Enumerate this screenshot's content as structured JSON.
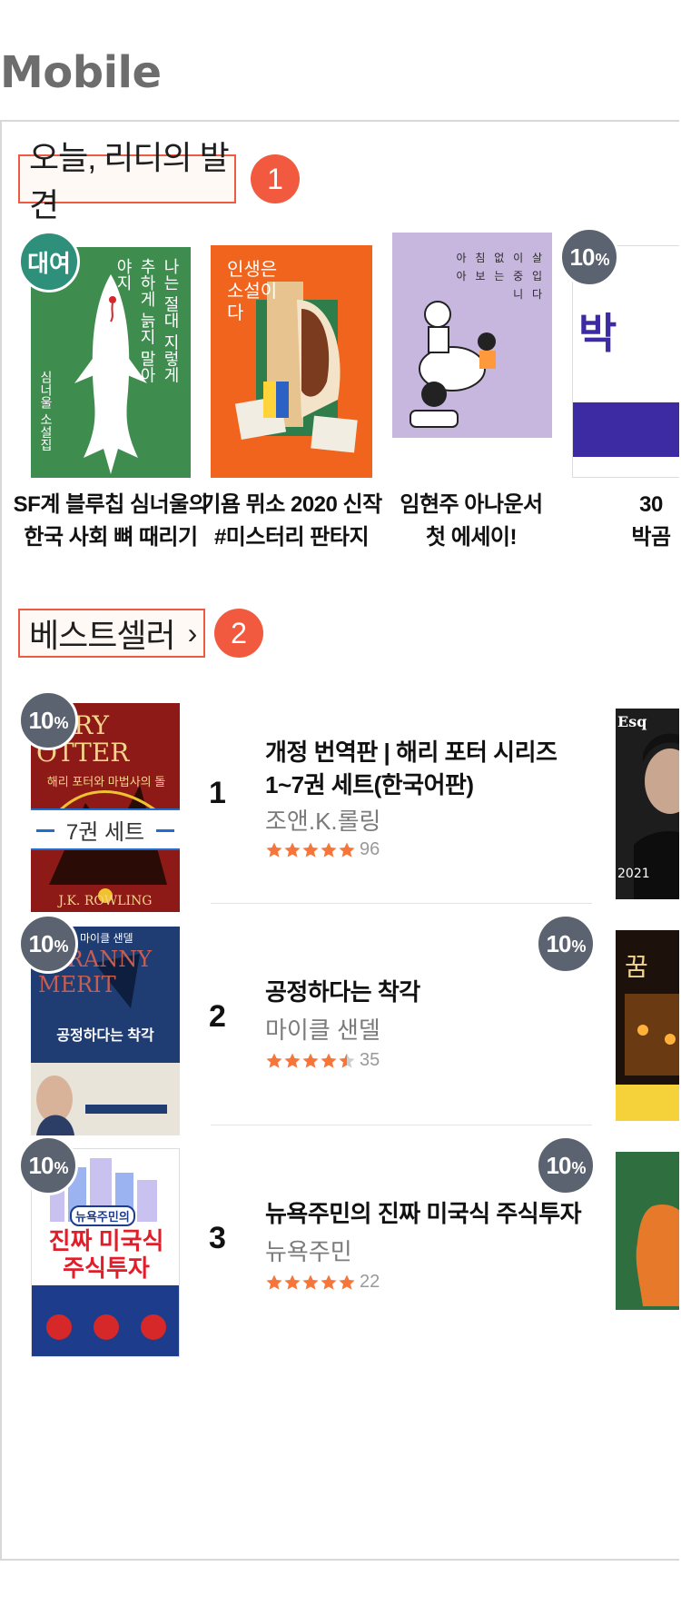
{
  "page_heading": "Mobile",
  "discover": {
    "title": "오늘, 리디의 발견",
    "number": "1",
    "items": [
      {
        "caption_line1": "SF계 블루칩 심너울의",
        "caption_line2": "한국 사회 뼈 때리기",
        "badge": "대여",
        "cover_text": "나는 절대 지렇게 추하게 늙지 말아야지",
        "cover_author": "심너울 소설집",
        "cover_color": "#3f8c4f"
      },
      {
        "caption_line1": "기욤 뮈소 2020 신작",
        "caption_line2": "#미스터리 판타지",
        "badge": "",
        "cover_text": "인생은 소설이다",
        "cover_color": "#f0641e"
      },
      {
        "caption_line1": "임현주 아나운서",
        "caption_line2": "첫 에세이!",
        "badge": "",
        "cover_text": "아 침 없 이 살 아 보 는 중 입 니 다",
        "cover_color": "#c7b6de"
      },
      {
        "caption_line1": "30",
        "caption_line2": "박곰",
        "badge": "10%",
        "cover_text": "박",
        "cover_color": "#ffffff"
      }
    ]
  },
  "bestseller": {
    "title": "베스트셀러",
    "number": "2",
    "items": [
      {
        "rank": "1",
        "title": "개정 번역판 | 해리 포터 시리즈 1~7권 세트(한국어판)",
        "author": "조앤.K.롤링",
        "rating": 5,
        "count": "96",
        "badge": "10%",
        "band": "7권 세트",
        "cover_text_top": "ARRY OTTER",
        "cover_sub": "해리 포터와 마법사의 돌",
        "cover_bottom": "J.K. ROWLING",
        "cover_color": "#a8201d"
      },
      {
        "rank": "2",
        "title": "공정하다는 착각",
        "author": "마이클 샌델",
        "rating": 4.5,
        "count": "35",
        "badge": "10%",
        "cover_text_top": "TYRANNY MERIT",
        "cover_sub": "공정하다는 착각",
        "cover_bottom": "마이클 샌델",
        "cover_color": "#1f3c73"
      },
      {
        "rank": "3",
        "title": "뉴욕주민의 진짜 미국식 주식투자",
        "author": "뉴욕주민",
        "rating": 5,
        "count": "22",
        "badge": "10%",
        "cover_text_top": "뉴욕주민의",
        "cover_sub": "진짜 미국식 주식투자",
        "cover_bottom": "",
        "cover_color": "#ffffff"
      }
    ],
    "side_badges": [
      "",
      "10%",
      "10%"
    ]
  },
  "colors": {
    "accent": "#f15a3e",
    "star": "#f5753b",
    "badge_gray": "#5c6370",
    "rent_green": "#2e8f7a"
  }
}
